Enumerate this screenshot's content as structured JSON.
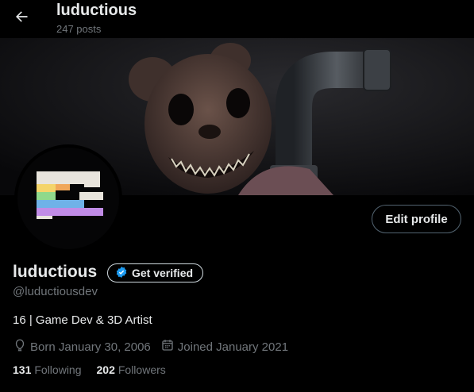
{
  "header": {
    "title": "luductious",
    "posts_count": "247 posts",
    "back_icon": "arrow-left-icon"
  },
  "profile": {
    "display_name": "luductious",
    "handle": "@luductiousdev",
    "bio": "16 | Game Dev & 3D Artist",
    "born": "Born January 30, 2006",
    "joined": "Joined January 2021",
    "following_count": "131",
    "following_label": "Following",
    "followers_count": "202",
    "followers_label": "Followers"
  },
  "buttons": {
    "edit_profile": "Edit profile",
    "get_verified": "Get verified"
  },
  "colors": {
    "background": "#000000",
    "verified_badge": "#1d9bf0",
    "muted_text": "#71767b",
    "text": "#e7e9ea"
  }
}
